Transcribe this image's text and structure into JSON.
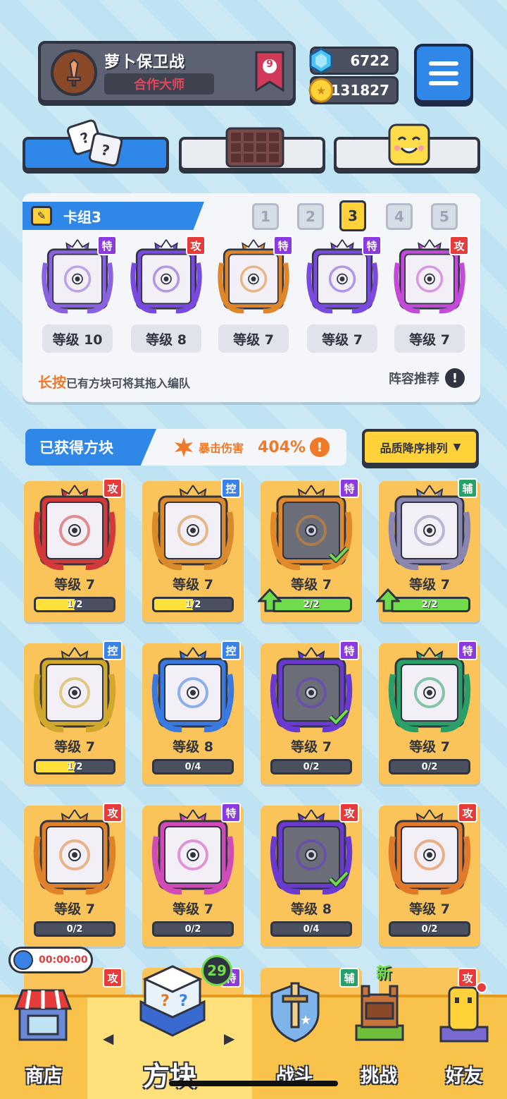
{
  "profile": {
    "name": "萝卜保卫战",
    "title": "合作大师",
    "rank": "9"
  },
  "currency": {
    "gems": "6722",
    "coins": "131827"
  },
  "deck": {
    "title": "卡组3",
    "slots": [
      "1",
      "2",
      "3",
      "4",
      "5"
    ],
    "active_slot": "3",
    "cards": [
      {
        "badge": "特",
        "type": "spc",
        "level": "等级 10",
        "color": "#8a62e0"
      },
      {
        "badge": "攻",
        "type": "atk",
        "level": "等级 8",
        "color": "#7a4ae0"
      },
      {
        "badge": "特",
        "type": "spc",
        "level": "等级 7",
        "color": "#e0862a"
      },
      {
        "badge": "特",
        "type": "spc",
        "level": "等级 7",
        "color": "#7a4ae0"
      },
      {
        "badge": "攻",
        "type": "atk",
        "level": "等级 7",
        "color": "#c44ad8"
      }
    ],
    "hint_strong": "长按",
    "hint_rest": "已有方块可将其拖入编队",
    "recommend": "阵容推荐"
  },
  "owned": {
    "title": "已获得方块",
    "crit_label": "暴击伤害",
    "crit_value": "404%",
    "sort_label": "品质降序排列"
  },
  "cards": [
    {
      "badge": "攻",
      "type": "atk",
      "level": "等级 7",
      "progress": "1/2",
      "fill": 0.5,
      "green": false,
      "check": false,
      "up": false,
      "color": "#d23a3a"
    },
    {
      "badge": "控",
      "type": "ctl",
      "level": "等级 7",
      "progress": "1/2",
      "fill": 0.5,
      "green": false,
      "check": false,
      "up": false,
      "color": "#d98a2a"
    },
    {
      "badge": "特",
      "type": "spc",
      "level": "等级 7",
      "progress": "2/2",
      "fill": 1,
      "green": true,
      "check": true,
      "up": true,
      "color": "#e08a2a"
    },
    {
      "badge": "辅",
      "type": "sup",
      "level": "等级 7",
      "progress": "2/2",
      "fill": 1,
      "green": true,
      "check": false,
      "up": true,
      "color": "#8a86b0"
    },
    {
      "badge": "控",
      "type": "ctl",
      "level": "等级 7",
      "progress": "1/2",
      "fill": 0.5,
      "green": false,
      "check": false,
      "up": false,
      "color": "#d2a82a"
    },
    {
      "badge": "控",
      "type": "ctl",
      "level": "等级 8",
      "progress": "0/4",
      "fill": 0,
      "green": false,
      "check": false,
      "up": false,
      "color": "#3a7ae0"
    },
    {
      "badge": "特",
      "type": "spc",
      "level": "等级 7",
      "progress": "0/2",
      "fill": 0,
      "green": false,
      "check": true,
      "up": false,
      "color": "#6a3ad0"
    },
    {
      "badge": "特",
      "type": "spc",
      "level": "等级 7",
      "progress": "0/2",
      "fill": 0,
      "green": false,
      "check": false,
      "up": false,
      "color": "#2aa068"
    },
    {
      "badge": "攻",
      "type": "atk",
      "level": "等级 7",
      "progress": "0/2",
      "fill": 0,
      "green": false,
      "check": false,
      "up": false,
      "color": "#e0822a"
    },
    {
      "badge": "特",
      "type": "spc",
      "level": "等级 7",
      "progress": "0/2",
      "fill": 0,
      "green": false,
      "check": false,
      "up": false,
      "color": "#d04ab8"
    },
    {
      "badge": "攻",
      "type": "atk",
      "level": "等级 8",
      "progress": "0/4",
      "fill": 0,
      "green": false,
      "check": true,
      "up": false,
      "color": "#6a3ad0"
    },
    {
      "badge": "攻",
      "type": "atk",
      "level": "等级 7",
      "progress": "0/2",
      "fill": 0,
      "green": false,
      "check": false,
      "up": false,
      "color": "#e07a2a"
    }
  ],
  "partial_cards": [
    {
      "badge": "攻",
      "type": "atk"
    },
    {
      "badge": "特",
      "type": "spc"
    },
    {
      "badge": "辅",
      "type": "sup"
    },
    {
      "badge": "攻",
      "type": "atk"
    }
  ],
  "timer": "00:00:00",
  "nav": {
    "shop": "商店",
    "blocks": "方块",
    "battle": "战斗",
    "challenge": "挑战",
    "friends": "好友",
    "blocks_count": "29",
    "new_tag": "新"
  }
}
